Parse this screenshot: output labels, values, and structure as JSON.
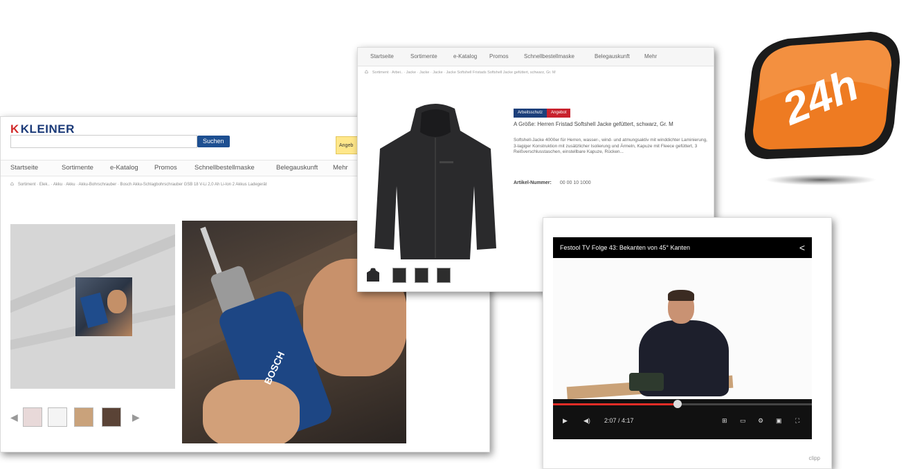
{
  "kleiner": {
    "logo_mark": "K",
    "logo_text": "KLEINER",
    "search_button": "Suchen",
    "yellow_button": "Angeb",
    "nav": [
      "Startseite",
      "Sortimente",
      "e-Katalog",
      "Promos",
      "Schnellbestellmaske",
      "Belegauskunft",
      "Mehr"
    ],
    "breadcrumb": "Sortiment · Elek.. · Akku · Akku · Akku-Bohrschrauber · Bosch Akku-Schlagbohrschrauber GSB 18 V-Li 2,0 Ah Li-Ion 2 Akkus Ladegerät",
    "thumbnails": [
      "",
      "",
      "",
      ""
    ],
    "photo_brand": "BOSCH"
  },
  "jacket": {
    "nav": [
      "Startseite",
      "Sortimente",
      "e-Katalog",
      "Promos",
      "Schnellbestellmaske",
      "Belegauskunft",
      "Mehr"
    ],
    "breadcrumb": "Sortiment · Arbei.. · Jacke · Jacke · Jacke · Jacke Softshell Fristads Softshell Jacke gefüttert, schwarz, Gr. M",
    "badges": [
      "Arbeitsschutz",
      "Angebot"
    ],
    "title": "A Größe: Herren Fristad Softshell Jacke gefüttert, schwarz, Gr. M",
    "description": "Softshell-Jacke 4000er für Herren, wasser-, wind- und atmungsaktiv mit winddichter Laminierung, 3-lagiger Konstruktion mit zusätzlicher Isolierung und Ärmeln, Kapuze mit Fleece gefüttert, 3 Reißverschlusstaschen, einstellbare Kapuze, Rücken...",
    "artnr_label": "Artikel-Nummer:",
    "artnr_value": "00 00 10 1000"
  },
  "video": {
    "title": "Festool TV Folge 43: Bekanten von 45° Kanten",
    "time": "2:07 / 4:17",
    "progress": 0.48,
    "source": "clipp"
  },
  "badge": {
    "text": "24h",
    "colors": {
      "orange": "#ee7b22",
      "dark": "#1b1b1b"
    }
  }
}
